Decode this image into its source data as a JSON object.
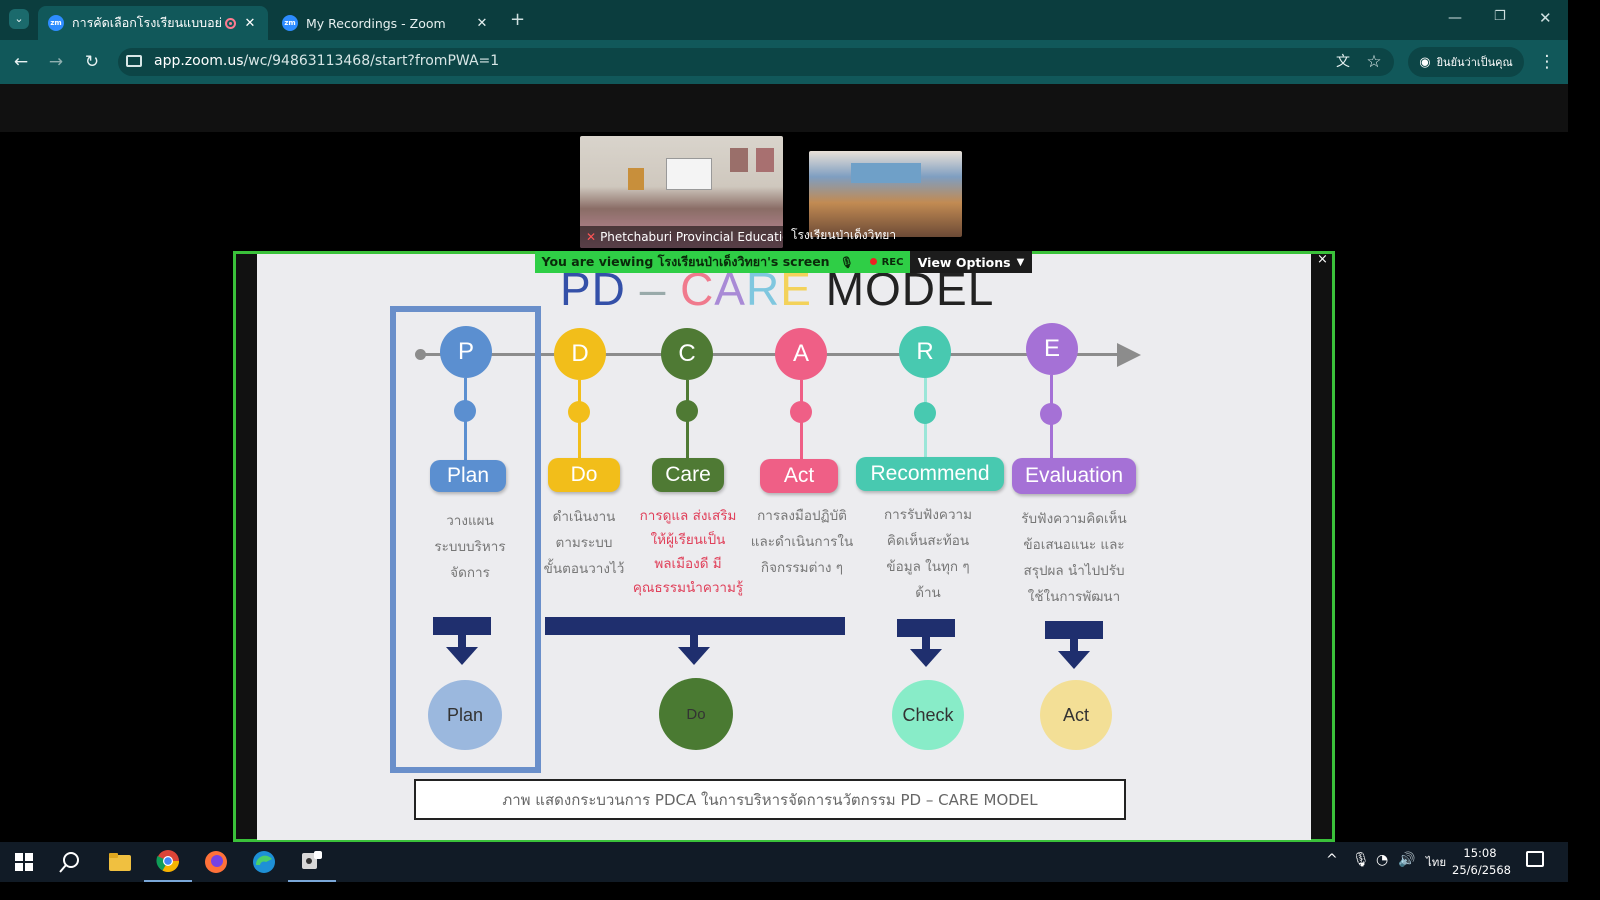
{
  "browser": {
    "tabs": [
      {
        "title": "การคัดเลือกโรงเรียนแบบอย่างการ",
        "active": true
      },
      {
        "title": "My Recordings - Zoom",
        "active": false
      }
    ],
    "new_tab": "+",
    "url_domain": "app.zoom.us",
    "url_path": "/wc/94863113468/start?fromPWA=1",
    "profile_label": "ยินยันว่าเป็นคุณ"
  },
  "zoom": {
    "participants": [
      {
        "name": "Phetchaburi Provincial Educatio..."
      },
      {
        "name": "โรงเรียนป่าเด็งวิทยา"
      }
    ],
    "banner": "You are viewing  โรงเรียนป่าเด็งวิทยา's screen",
    "rec_label": "REC",
    "view_options": "View Options",
    "close_glyph": "×"
  },
  "slide": {
    "title_pd": "PD",
    "title_dash": "–",
    "title_care": [
      "C",
      "A",
      "R",
      "E"
    ],
    "title_model": "MODEL",
    "steps": [
      {
        "letter": "P",
        "label": "Plan",
        "color": "#5b8fd0",
        "desc": [
          "วางแผน",
          "ระบบบริหาร",
          "จัดการ"
        ],
        "desc_red": false
      },
      {
        "letter": "D",
        "label": "Do",
        "color": "#f2be1a",
        "desc": [
          "ดำเนินงาน",
          "ตามระบบ",
          "ขั้นตอนวางไว้"
        ],
        "desc_red": false
      },
      {
        "letter": "C",
        "label": "Care",
        "color": "#4f7a34",
        "desc": [
          "การดูแล ส่งเสริม",
          "ให้ผู้เรียนเป็น",
          "พลเมืองดี มี",
          "คุณธรรมนำความรู้"
        ],
        "desc_red": true
      },
      {
        "letter": "A",
        "label": "Act",
        "color": "#ef5f86",
        "desc": [
          "การลงมือปฏิบัติ",
          "และดำเนินการใน",
          "กิจกรรมต่าง ๆ"
        ],
        "desc_red": false
      },
      {
        "letter": "R",
        "label": "Recommend",
        "color": "#48c9b0",
        "desc": [
          "การรับฟังความ",
          "คิดเห็นสะท้อน",
          "ข้อมูล ในทุก ๆ",
          "ด้าน"
        ],
        "desc_red": false
      },
      {
        "letter": "E",
        "label": "Evaluation",
        "color": "#a571d6",
        "desc": [
          "รับฟังความคิดเห็น",
          "ข้อเสนอแนะ และ",
          "สรุปผล นำไปปรับ",
          "ใช้ในการพัฒนา"
        ],
        "desc_red": false
      }
    ],
    "pdca": [
      {
        "label": "Plan",
        "color": "#9bb8de"
      },
      {
        "label": "Do",
        "color": "#4a7a32"
      },
      {
        "label": "Check",
        "color": "#88ecc8"
      },
      {
        "label": "Act",
        "color": "#f3df96"
      }
    ],
    "caption": "ภาพ แสดงกระบวนการ PDCA ในการบริหารจัดการนวัตกรรม PD – CARE MODEL"
  },
  "taskbar": {
    "lang": "ไทย",
    "time": "15:08",
    "date": "25/6/2568"
  }
}
